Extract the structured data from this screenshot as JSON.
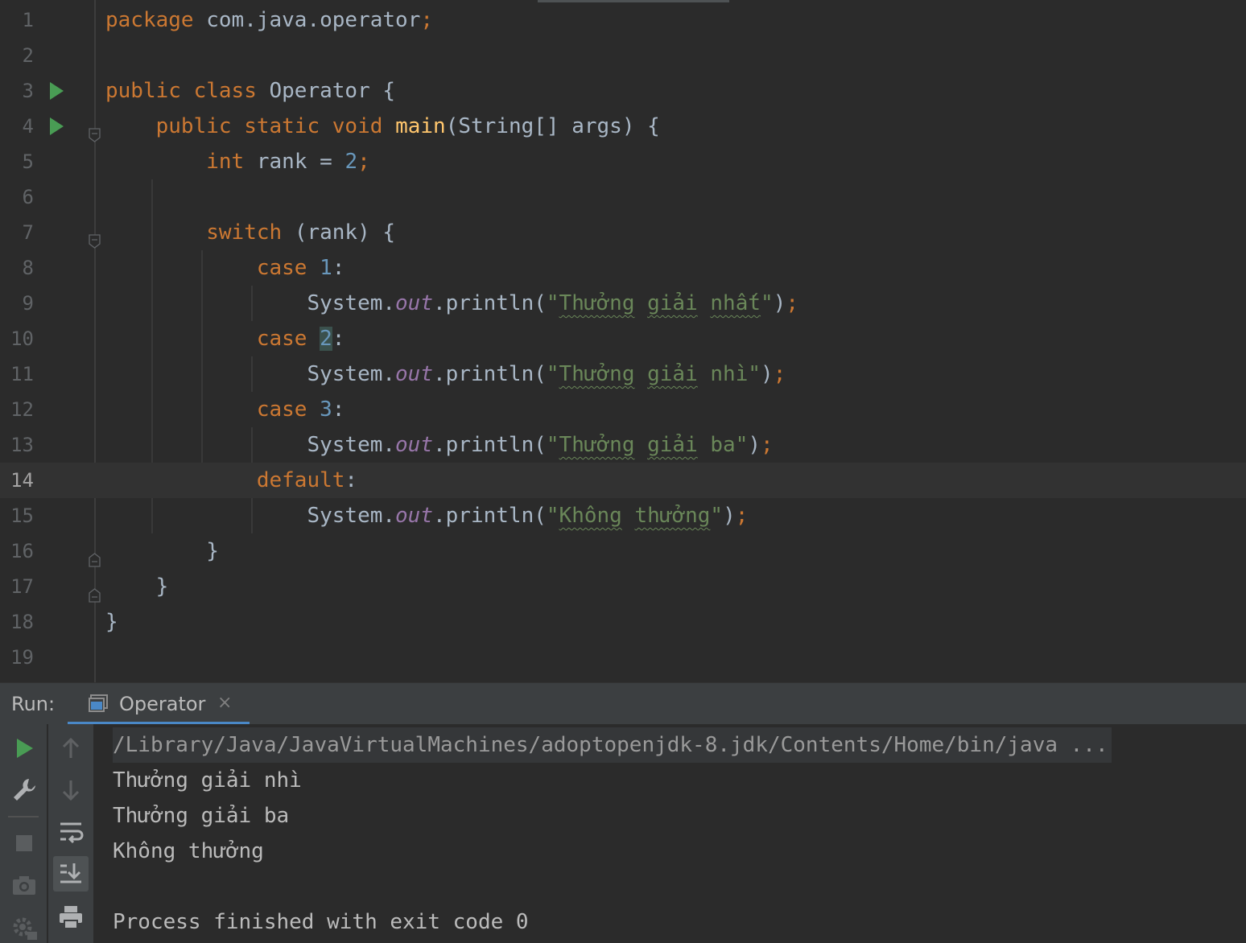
{
  "editor": {
    "line_numbers": [
      "1",
      "2",
      "3",
      "4",
      "5",
      "6",
      "7",
      "8",
      "9",
      "10",
      "11",
      "12",
      "13",
      "14",
      "15",
      "16",
      "17",
      "18",
      "19"
    ],
    "current_line": 14,
    "lines": [
      [
        {
          "t": "package ",
          "c": "kw"
        },
        {
          "t": "com.java.operator",
          "c": "plain"
        },
        {
          "t": ";",
          "c": "semi"
        }
      ],
      [],
      [
        {
          "t": "public ",
          "c": "kw"
        },
        {
          "t": "class ",
          "c": "kw"
        },
        {
          "t": "Operator ",
          "c": "plain"
        },
        {
          "t": "{",
          "c": "plain"
        }
      ],
      [
        {
          "t": "    "
        },
        {
          "t": "public ",
          "c": "kw"
        },
        {
          "t": "static ",
          "c": "kw"
        },
        {
          "t": "void ",
          "c": "kw"
        },
        {
          "t": "main",
          "c": "fn"
        },
        {
          "t": "(String[] args) {",
          "c": "plain"
        }
      ],
      [
        {
          "t": "        "
        },
        {
          "t": "int ",
          "c": "kw"
        },
        {
          "t": "rank = ",
          "c": "plain"
        },
        {
          "t": "2",
          "c": "num"
        },
        {
          "t": ";",
          "c": "semi"
        }
      ],
      [],
      [
        {
          "t": "        "
        },
        {
          "t": "switch ",
          "c": "kw"
        },
        {
          "t": "(rank) {",
          "c": "plain"
        }
      ],
      [
        {
          "t": "            "
        },
        {
          "t": "case ",
          "c": "kw"
        },
        {
          "t": "1",
          "c": "num"
        },
        {
          "t": ":",
          "c": "plain"
        }
      ],
      [
        {
          "t": "                "
        },
        {
          "t": "System.",
          "c": "plain"
        },
        {
          "t": "out",
          "c": "field"
        },
        {
          "t": ".println(",
          "c": "plain"
        },
        {
          "t": "\"",
          "c": "str"
        },
        {
          "t": "Thưởng",
          "c": "str squig"
        },
        {
          "t": " ",
          "c": "str"
        },
        {
          "t": "giải",
          "c": "str squig"
        },
        {
          "t": " ",
          "c": "str"
        },
        {
          "t": "nhất",
          "c": "str squig"
        },
        {
          "t": "\"",
          "c": "str"
        },
        {
          "t": ")",
          "c": "plain"
        },
        {
          "t": ";",
          "c": "semi"
        }
      ],
      [
        {
          "t": "            "
        },
        {
          "t": "case ",
          "c": "kw"
        },
        {
          "t": "2",
          "c": "num hl-num"
        },
        {
          "t": ":",
          "c": "plain"
        }
      ],
      [
        {
          "t": "                "
        },
        {
          "t": "System.",
          "c": "plain"
        },
        {
          "t": "out",
          "c": "field"
        },
        {
          "t": ".println(",
          "c": "plain"
        },
        {
          "t": "\"",
          "c": "str"
        },
        {
          "t": "Thưởng",
          "c": "str squig"
        },
        {
          "t": " ",
          "c": "str"
        },
        {
          "t": "giải",
          "c": "str squig"
        },
        {
          "t": " nhì\"",
          "c": "str"
        },
        {
          "t": ")",
          "c": "plain"
        },
        {
          "t": ";",
          "c": "semi"
        }
      ],
      [
        {
          "t": "            "
        },
        {
          "t": "case ",
          "c": "kw"
        },
        {
          "t": "3",
          "c": "num"
        },
        {
          "t": ":",
          "c": "plain"
        }
      ],
      [
        {
          "t": "                "
        },
        {
          "t": "System.",
          "c": "plain"
        },
        {
          "t": "out",
          "c": "field"
        },
        {
          "t": ".println(",
          "c": "plain"
        },
        {
          "t": "\"",
          "c": "str"
        },
        {
          "t": "Thưởng",
          "c": "str squig"
        },
        {
          "t": " ",
          "c": "str"
        },
        {
          "t": "giải",
          "c": "str squig"
        },
        {
          "t": " ba\"",
          "c": "str"
        },
        {
          "t": ")",
          "c": "plain"
        },
        {
          "t": ";",
          "c": "semi"
        }
      ],
      [
        {
          "t": "            "
        },
        {
          "t": "default",
          "c": "kw"
        },
        {
          "t": ":",
          "c": "plain"
        }
      ],
      [
        {
          "t": "                "
        },
        {
          "t": "System.",
          "c": "plain"
        },
        {
          "t": "out",
          "c": "field"
        },
        {
          "t": ".println(",
          "c": "plain"
        },
        {
          "t": "\"",
          "c": "str"
        },
        {
          "t": "Không",
          "c": "str squig"
        },
        {
          "t": " ",
          "c": "str"
        },
        {
          "t": "thưởng",
          "c": "str squig"
        },
        {
          "t": "\"",
          "c": "str"
        },
        {
          "t": ")",
          "c": "plain"
        },
        {
          "t": ";",
          "c": "semi"
        }
      ],
      [
        {
          "t": "        "
        },
        {
          "t": "}",
          "c": "plain"
        }
      ],
      [
        {
          "t": "    "
        },
        {
          "t": "}",
          "c": "plain"
        }
      ],
      [
        {
          "t": "}",
          "c": "plain"
        }
      ],
      []
    ],
    "run_markers_on_lines": [
      3,
      4
    ],
    "fold_open_lines": [
      4,
      7
    ],
    "fold_close_lines": [
      16,
      17
    ]
  },
  "run_panel": {
    "label": "Run:",
    "tab": {
      "label": "Operator",
      "close_glyph": "×"
    },
    "console": {
      "command_line": "/Library/Java/JavaVirtualMachines/adoptopenjdk-8.jdk/Contents/Home/bin/java ...",
      "output": [
        "Thưởng giải nhì",
        "Thưởng giải ba",
        "Không thưởng",
        ""
      ],
      "exit_message": "Process finished with exit code 0"
    },
    "toolbar_left": [
      "run-icon",
      "wrench-icon",
      "stop-icon",
      "camera-icon",
      "settings-icon"
    ],
    "toolbar_right": [
      "arrow-up-icon",
      "arrow-down-icon",
      "soft-wrap-icon",
      "scroll-to-end-icon",
      "print-icon"
    ],
    "colors": {
      "run_green": "#499c54",
      "tab_accent": "#4a88c7",
      "keyword": "#cc7832",
      "string": "#6a8759",
      "number": "#6897bb",
      "field": "#9876aa",
      "method": "#ffc66d"
    }
  }
}
